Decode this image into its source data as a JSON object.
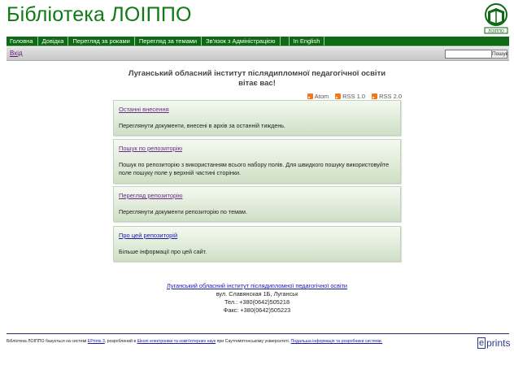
{
  "header": {
    "title": "Бібліотека ЛОІППО",
    "logo_icon": "library-book-logo",
    "logo_text": "ЛОІППО"
  },
  "menu": [
    {
      "label": "Головна"
    },
    {
      "label": "Довідка"
    },
    {
      "label": "Перегляд за роками"
    },
    {
      "label": "Перегляд за темами"
    },
    {
      "label": "Зв'язок з Адміністрацією"
    },
    {
      "label": "In English"
    }
  ],
  "toolbar": {
    "login": "Вхід",
    "search_value": "",
    "search_button": "Пошук"
  },
  "welcome": {
    "line1": "Луганський обласний інститут післядипломної педагогічної освіти",
    "line2": "вітає вас!"
  },
  "feeds": [
    {
      "label": "Atom"
    },
    {
      "label": "RSS 1.0"
    },
    {
      "label": "RSS 2.0"
    }
  ],
  "panels": [
    {
      "title": "Останні внесення",
      "desc": "Переглянути документи, внесені в архів за останній тиждень."
    },
    {
      "title": "Пошук по репозиторію",
      "desc": "Пошук по репозиторію з використанням всього набору полів. Для швидкого пошуку використовуйте поле пошуку поле у верхній частині сторінки."
    },
    {
      "title": "Перегляд репозиторію",
      "desc": "Переглянути документи репозиторію по темам."
    },
    {
      "title": "Про цей репозиторій",
      "desc": "Більше інформації про цей сайт."
    }
  ],
  "contact": {
    "org_link": "Луганський обласний інститут післядипломної педагогічної освіти",
    "address": "вул. Славянская 1Б, Луганськ",
    "phone": "Тел.: +380(0642)505218",
    "fax": "Факс: +380(0642)505223"
  },
  "footer": {
    "t1": "Бібліотека ЛОІППО базується на системі ",
    "l1": "EPrints 3",
    "t2": ", розроблений в ",
    "l2": "Школі електроніки та комп'ютерних наук",
    "t3": " при Саутгемптонському університеті. ",
    "l3": "Подальша інформація та розробники системи.",
    "logo_text": "prints",
    "logo_letter": "e"
  },
  "colors": {
    "brand_green": "#0e6a14",
    "title_green": "#0d7a12",
    "panel_green": "#cfe0c6",
    "feed_orange": "#f07a1b"
  }
}
